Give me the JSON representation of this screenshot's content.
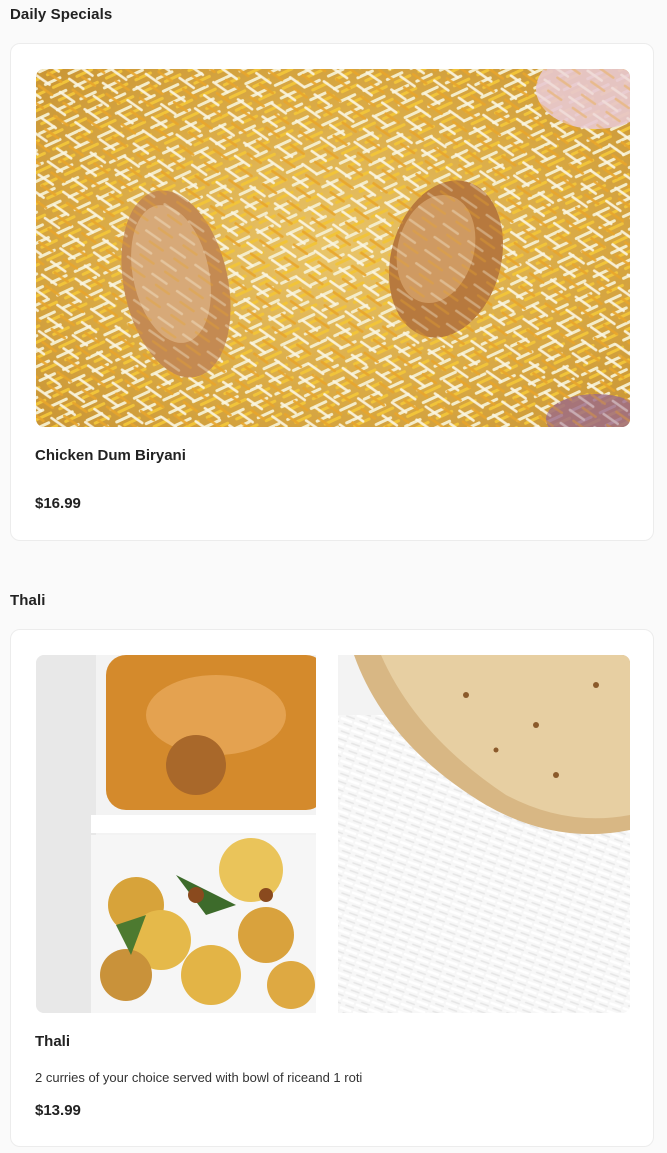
{
  "sections": [
    {
      "title": "Daily Specials",
      "items": [
        {
          "name": "Chicken Dum Biryani",
          "description": "",
          "price": "$16.99",
          "image_icon": "biryani-photo"
        }
      ]
    },
    {
      "title": "Thali",
      "items": [
        {
          "name": "Thali",
          "description": "2 curries of your choice served with bowl of riceand 1 roti",
          "price": "$13.99",
          "image_icon": "thali-photo"
        }
      ]
    }
  ],
  "colors": {
    "page_background": "#fafafa",
    "card_background": "#ffffff",
    "card_border": "#ececec",
    "text": "#222222"
  }
}
